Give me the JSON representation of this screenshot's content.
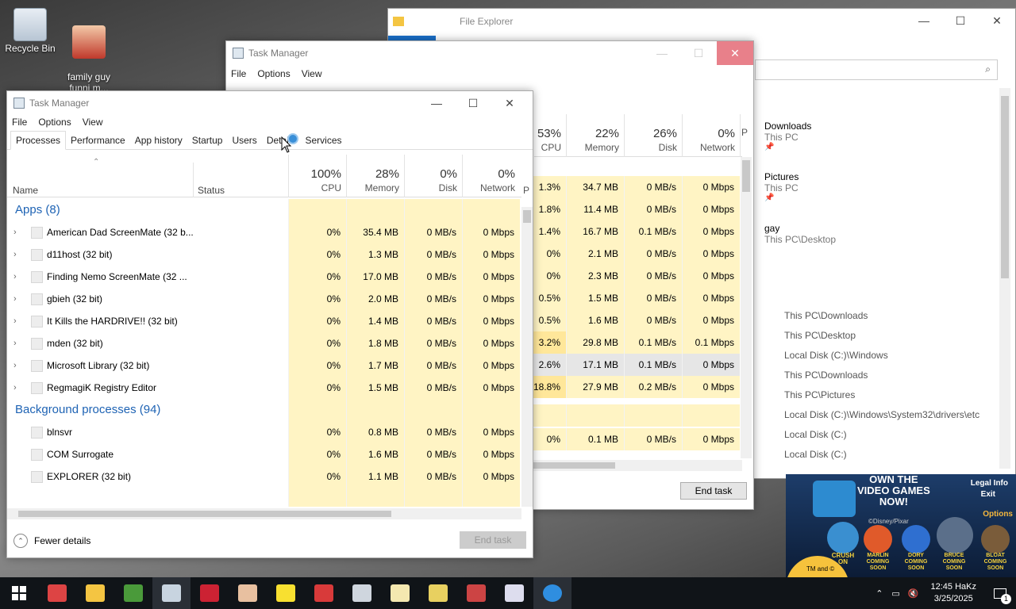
{
  "desktop": {
    "icons": [
      {
        "label": "Recycle Bin"
      },
      {
        "label": "family guy\nfunni m..."
      }
    ]
  },
  "file_explorer": {
    "title": "File Explorer",
    "quick_access": [
      {
        "name": "Downloads",
        "sub": "This PC"
      },
      {
        "name": "Pictures",
        "sub": "This PC"
      },
      {
        "name": "gay",
        "sub": "This PC\\Desktop"
      }
    ],
    "recent": [
      "This PC\\Downloads",
      "This PC\\Desktop",
      "Local Disk (C:)\\Windows",
      "This PC\\Downloads",
      "This PC\\Pictures",
      "Local Disk (C:)\\Windows\\System32\\drivers\\etc",
      "Local Disk (C:)",
      "Local Disk (C:)"
    ]
  },
  "tm_back": {
    "title": "Task Manager",
    "menu": [
      "File",
      "Options",
      "View"
    ],
    "columns": [
      {
        "pct": "53%",
        "label": "CPU"
      },
      {
        "pct": "22%",
        "label": "Memory"
      },
      {
        "pct": "26%",
        "label": "Disk"
      },
      {
        "pct": "0%",
        "label": "Network"
      },
      {
        "pct": "",
        "label": "P"
      }
    ],
    "rows": [
      [
        "1.3%",
        "34.7 MB",
        "0 MB/s",
        "0 Mbps"
      ],
      [
        "1.8%",
        "11.4 MB",
        "0 MB/s",
        "0 Mbps"
      ],
      [
        "1.4%",
        "16.7 MB",
        "0.1 MB/s",
        "0 Mbps"
      ],
      [
        "0%",
        "2.1 MB",
        "0 MB/s",
        "0 Mbps"
      ],
      [
        "0%",
        "2.3 MB",
        "0 MB/s",
        "0 Mbps"
      ],
      [
        "0.5%",
        "1.5 MB",
        "0 MB/s",
        "0 Mbps"
      ],
      [
        "0.5%",
        "1.6 MB",
        "0 MB/s",
        "0 Mbps"
      ],
      [
        "3.2%",
        "29.8 MB",
        "0.1 MB/s",
        "0.1 Mbps"
      ],
      [
        "2.6%",
        "17.1 MB",
        "0.1 MB/s",
        "0 Mbps"
      ],
      [
        "18.8%",
        "27.9 MB",
        "0.2 MB/s",
        "0 Mbps"
      ]
    ],
    "extra_row": [
      "0%",
      "0.1 MB",
      "0 MB/s",
      "0 Mbps"
    ],
    "end_task": "End task"
  },
  "tm_front": {
    "title": "Task Manager",
    "menu": [
      "File",
      "Options",
      "View"
    ],
    "tabs": [
      "Processes",
      "Performance",
      "App history",
      "Startup",
      "Users",
      "Details",
      "Services"
    ],
    "headers": {
      "name": "Name",
      "status": "Status",
      "cpu_pct": "100%",
      "cpu": "CPU",
      "mem_pct": "28%",
      "mem": "Memory",
      "disk_pct": "0%",
      "disk": "Disk",
      "net_pct": "0%",
      "net": "Network",
      "power": "P"
    },
    "apps_group": "Apps (8)",
    "apps": [
      {
        "name": "American Dad ScreenMate (32 b...",
        "cpu": "0%",
        "mem": "35.4 MB",
        "disk": "0 MB/s",
        "net": "0 Mbps"
      },
      {
        "name": "d11host (32 bit)",
        "cpu": "0%",
        "mem": "1.3 MB",
        "disk": "0 MB/s",
        "net": "0 Mbps"
      },
      {
        "name": "Finding Nemo ScreenMate (32 ...",
        "cpu": "0%",
        "mem": "17.0 MB",
        "disk": "0 MB/s",
        "net": "0 Mbps"
      },
      {
        "name": "gbieh (32 bit)",
        "cpu": "0%",
        "mem": "2.0 MB",
        "disk": "0 MB/s",
        "net": "0 Mbps"
      },
      {
        "name": "It Kills the HARDRIVE!! (32 bit)",
        "cpu": "0%",
        "mem": "1.4 MB",
        "disk": "0 MB/s",
        "net": "0 Mbps"
      },
      {
        "name": "mden (32 bit)",
        "cpu": "0%",
        "mem": "1.8 MB",
        "disk": "0 MB/s",
        "net": "0 Mbps"
      },
      {
        "name": "Microsoft Library (32 bit)",
        "cpu": "0%",
        "mem": "1.7 MB",
        "disk": "0 MB/s",
        "net": "0 Mbps"
      },
      {
        "name": "RegmagiK Registry Editor",
        "cpu": "0%",
        "mem": "1.5 MB",
        "disk": "0 MB/s",
        "net": "0 Mbps"
      }
    ],
    "bg_group": "Background processes (94)",
    "background": [
      {
        "name": "blnsvr",
        "cpu": "0%",
        "mem": "0.8 MB",
        "disk": "0 MB/s",
        "net": "0 Mbps"
      },
      {
        "name": "COM Surrogate",
        "cpu": "0%",
        "mem": "1.6 MB",
        "disk": "0 MB/s",
        "net": "0 Mbps"
      },
      {
        "name": "EXPLORER (32 bit)",
        "cpu": "0%",
        "mem": "1.1 MB",
        "disk": "0 MB/s",
        "net": "0 Mbps"
      }
    ],
    "fewer_details": "Fewer details",
    "end_task": "End task"
  },
  "ad": {
    "headline": "OWN THE\nVIDEO GAMES\nNOW!",
    "legal": "Legal Info",
    "exit": "Exit",
    "options": "Options",
    "brand": "©Disney/Pixar",
    "tm": "TM and ©",
    "games": [
      "CRUSH\nON",
      "MARLIN\nCOMING\nSOON",
      "DORY\nCOMING\nSOON",
      "BRUCE\nCOMING\nSOON",
      "BLOAT\nCOMING\nSOON"
    ]
  },
  "taskbar": {
    "clock_time": "12:45 HaKz",
    "clock_date": "3/25/2025",
    "notification_count": "1"
  },
  "colors": {
    "accent": "#1e63b4",
    "heat_light": "#fff4c4",
    "heat_dark": "#ffe79a",
    "close_red": "#e8808a"
  }
}
